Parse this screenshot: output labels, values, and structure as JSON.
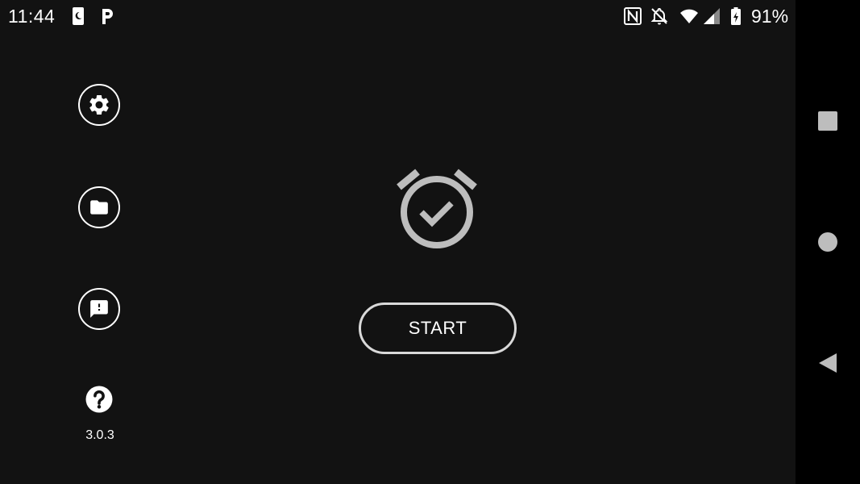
{
  "status_bar": {
    "time": "11:44",
    "battery_percent": "91%",
    "left_icons": [
      "phone-moon-icon",
      "p-app-icon"
    ],
    "right_icons": [
      "nfc-icon",
      "bell-off-icon",
      "wifi-icon",
      "cell-signal-icon",
      "battery-charging-icon"
    ]
  },
  "sidebar": {
    "buttons": [
      {
        "name": "settings",
        "icon": "gear-icon"
      },
      {
        "name": "folder",
        "icon": "folder-icon"
      },
      {
        "name": "feedback",
        "icon": "feedback-icon"
      },
      {
        "name": "help",
        "icon": "help-icon"
      }
    ],
    "version": "3.0.3"
  },
  "main": {
    "icon": "alarm-check-icon",
    "start_label": "START"
  },
  "nav_bar": {
    "buttons": [
      "recents-square-icon",
      "home-circle-icon",
      "back-triangle-icon"
    ]
  },
  "colors": {
    "background": "#121212",
    "nav_background": "#000000",
    "icon_gray": "#bdbdbd",
    "button_border": "#d9d9d9",
    "text": "#ffffff"
  }
}
